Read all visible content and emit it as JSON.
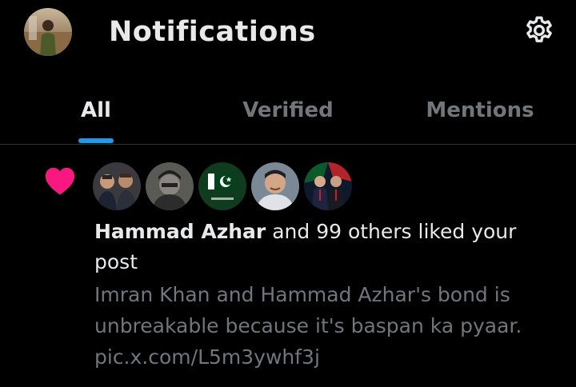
{
  "header": {
    "title": "Notifications",
    "avatar_icon": "profile-avatar",
    "settings_icon": "gear-icon"
  },
  "tabs": [
    {
      "label": "All",
      "active": true
    },
    {
      "label": "Verified",
      "active": false
    },
    {
      "label": "Mentions",
      "active": false
    }
  ],
  "colors": {
    "background": "#000000",
    "text_primary": "#e7e9ea",
    "text_secondary": "#71767b",
    "accent": "#1d9bf0",
    "like": "#f91880",
    "divider": "#2f3336"
  },
  "notification": {
    "type_icon": "heart-icon",
    "actor_name": "Hammad Azhar",
    "action_text": " and 99 others liked your post",
    "post_lines": [
      "Imran Khan and Hammad Azhar's bond is",
      "unbreakable because it's baspan ka pyaar.",
      "pic.x.com/L5m3ywhf3j"
    ]
  }
}
